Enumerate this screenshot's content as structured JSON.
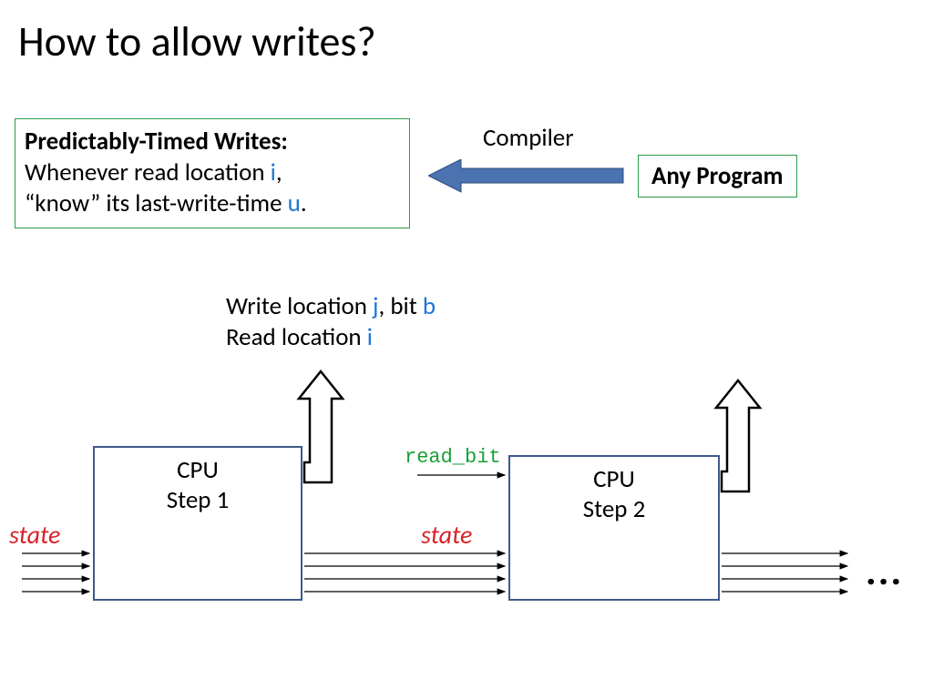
{
  "title": "How to allow writes?",
  "ptw": {
    "heading": "Predictably-Timed Writes:",
    "line1a": "Whenever read location ",
    "var_i": "i",
    "line1b": ",",
    "line2a": "“know” its last-write-time ",
    "var_u": "u",
    "line2b": "."
  },
  "compiler_label": "Compiler",
  "any_program": "Any Program",
  "mid": {
    "write_a": "Write location ",
    "var_j": "j",
    "write_b": ", bit ",
    "var_b": "b",
    "read_a": "Read location ",
    "var_i": "i"
  },
  "cpu1_line1": "CPU",
  "cpu1_line2": "Step 1",
  "cpu2_line1": "CPU",
  "cpu2_line2": "Step 2",
  "state_label": "state",
  "readbit_label": "read_bit",
  "dots": "..."
}
